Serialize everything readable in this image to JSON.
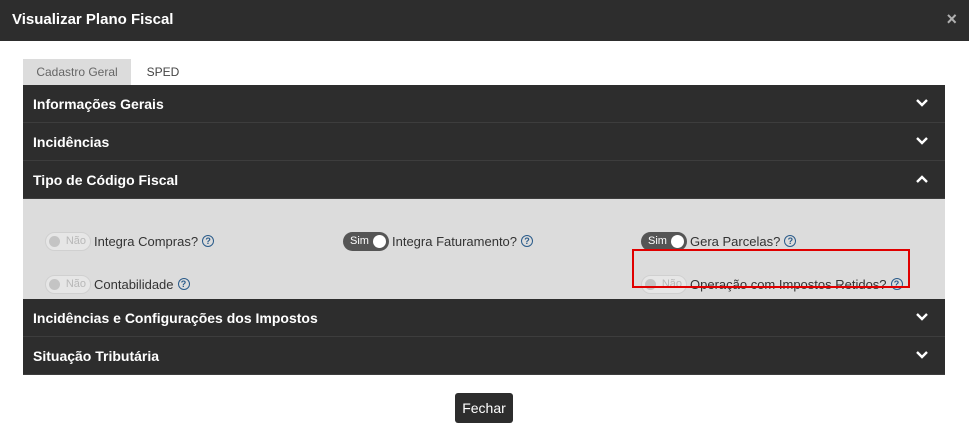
{
  "modal": {
    "title": "Visualizar Plano Fiscal",
    "close_icon": "×"
  },
  "tabs": [
    {
      "label": "Cadastro Geral",
      "active": true
    },
    {
      "label": "SPED",
      "active": false
    }
  ],
  "sections": {
    "info_gerais": "Informações Gerais",
    "incidencias": "Incidências",
    "tipo_codigo": "Tipo de Código Fiscal",
    "incid_config": "Incidências e Configurações dos Impostos",
    "situacao": "Situação Tributária"
  },
  "fields": {
    "integra_compras": {
      "label": "Integra Compras?",
      "state": "Não"
    },
    "integra_faturamento": {
      "label": "Integra Faturamento?",
      "state": "Sim"
    },
    "gera_parcelas": {
      "label": "Gera Parcelas?",
      "state": "Sim"
    },
    "contabilidade": {
      "label": "Contabilidade",
      "state": "Não"
    },
    "operacao_impostos": {
      "label": "Operação com Impostos Retidos?",
      "state": "Não"
    }
  },
  "help_glyph": "?",
  "footer": {
    "close_label": "Fechar"
  },
  "colors": {
    "dark": "#2d2d2d",
    "panel": "#dcdcdc",
    "highlight": "#e00000",
    "help": "#2a5b8a"
  }
}
